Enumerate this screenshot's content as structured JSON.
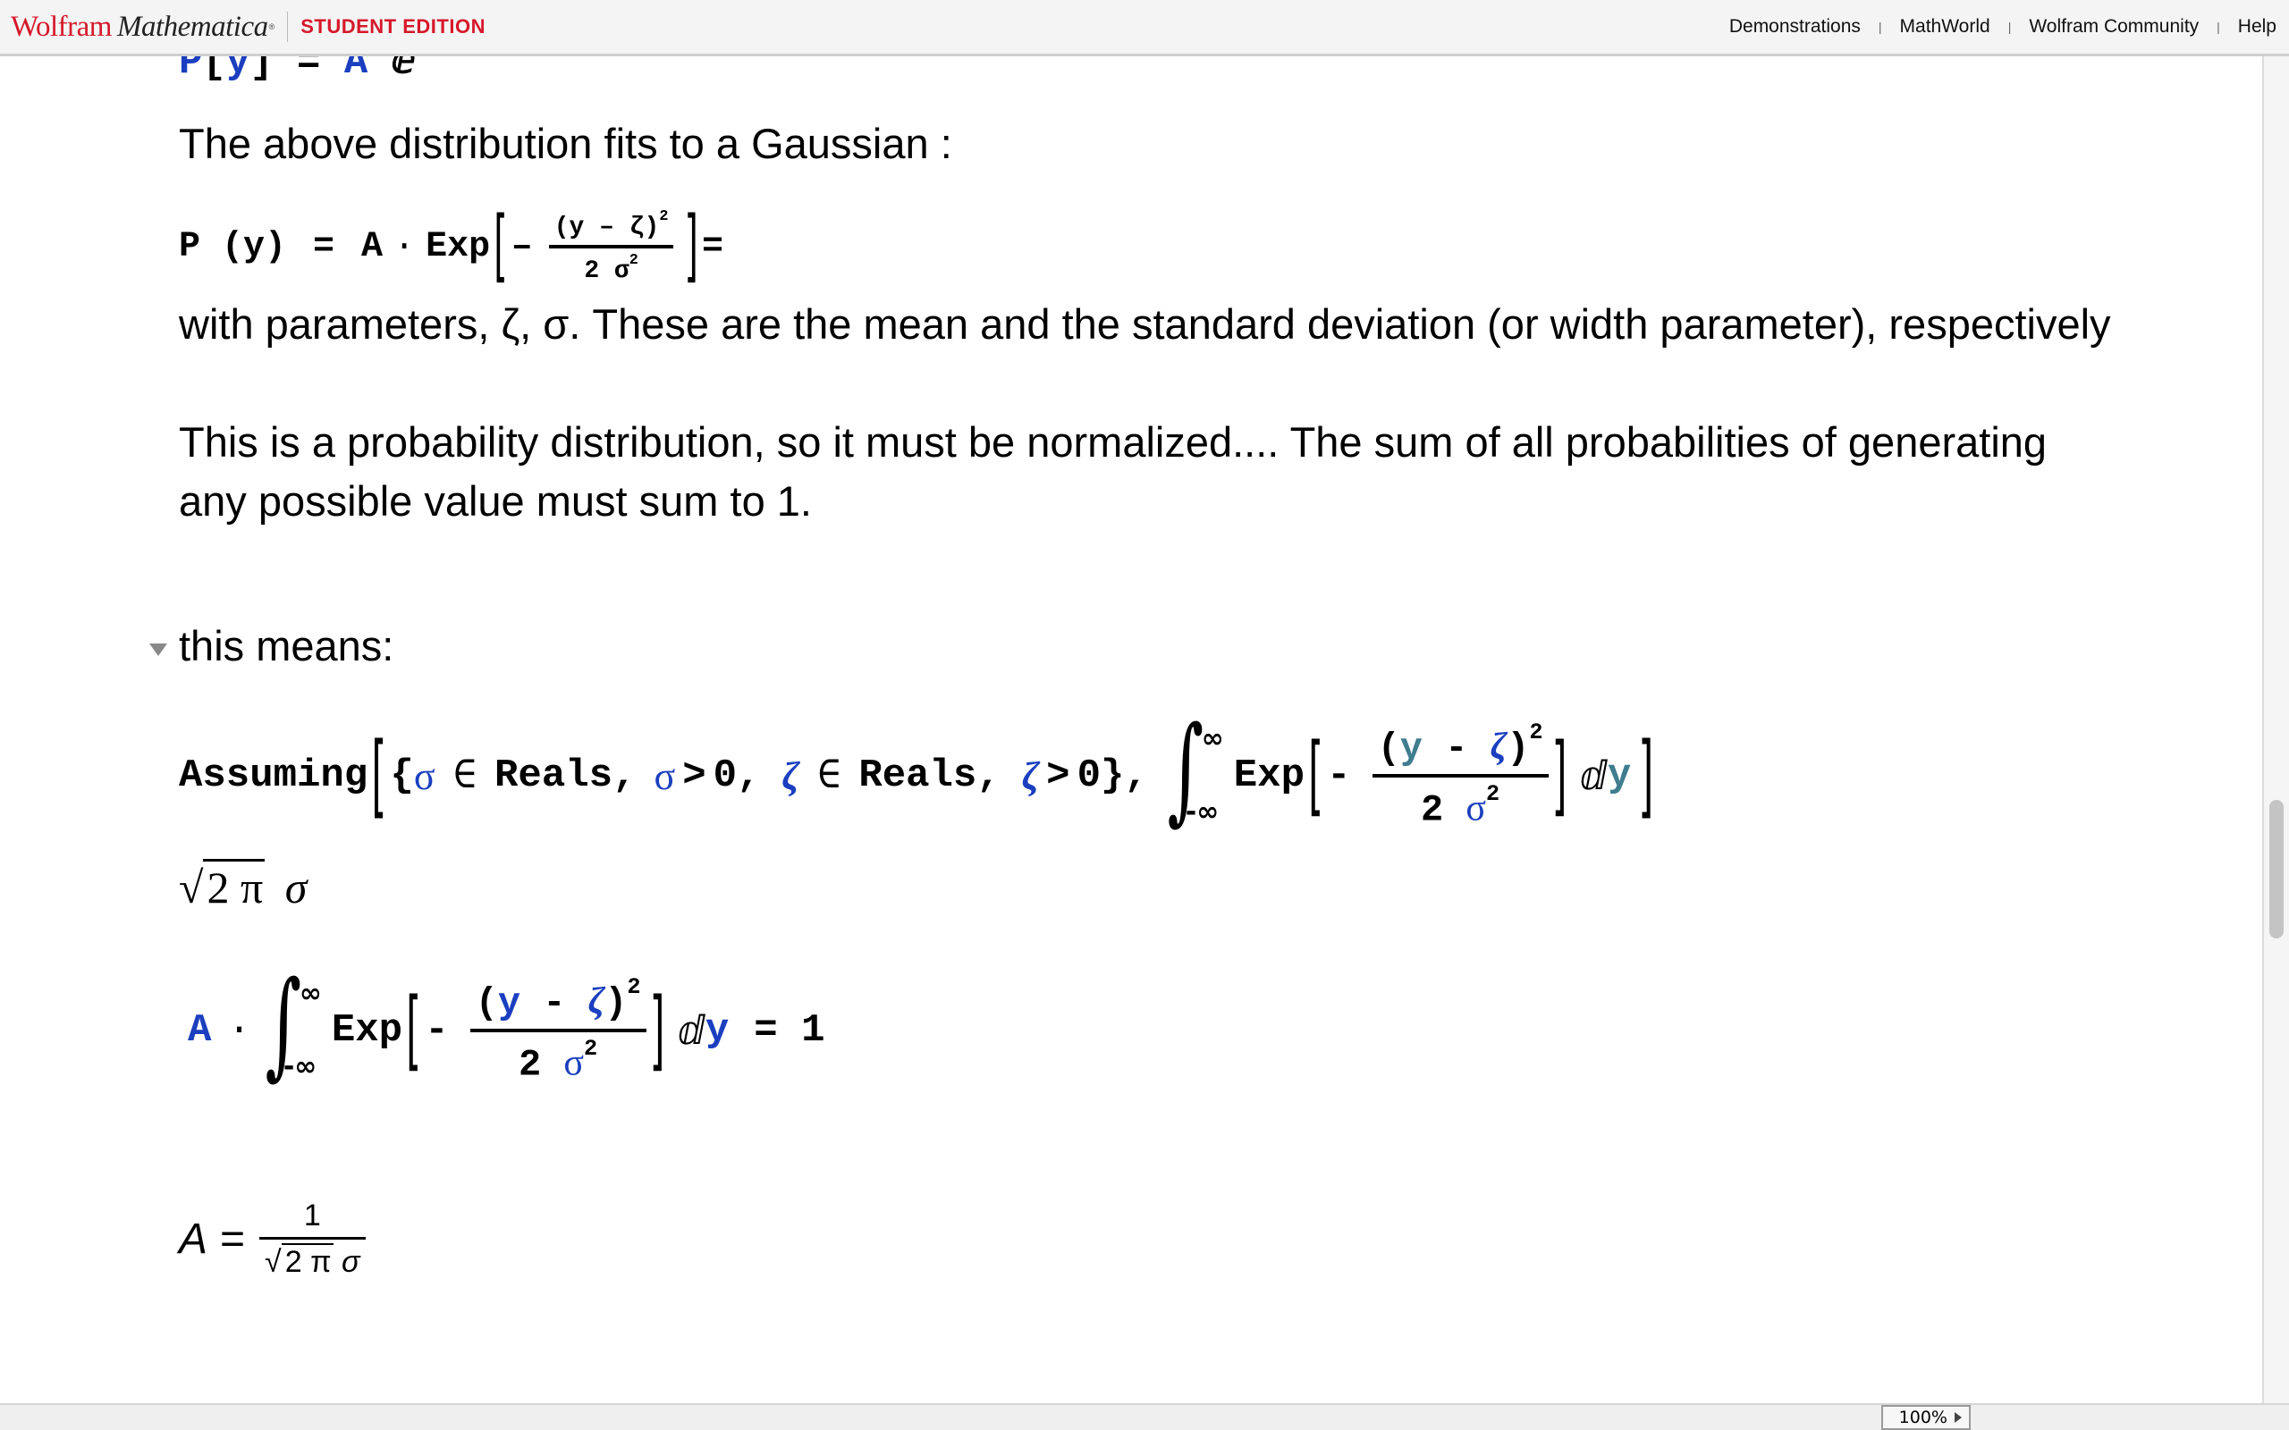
{
  "header": {
    "brand_wolfram": "Wolfram",
    "brand_mathematica": "Mathematica",
    "brand_tm": "®",
    "edition": "STUDENT EDITION",
    "links": [
      "Demonstrations",
      "MathWorld",
      "Wolfram Community",
      "Help"
    ],
    "link_separator": "|"
  },
  "notebook": {
    "partial_top_line": {
      "P": "P",
      "lbr": "[",
      "y": "y",
      "rbr": "]",
      "eq": "=",
      "A": "A",
      "e": "ⅇ"
    },
    "text_gaussian_intro": "The above distribution fits to a Gaussian :",
    "gaussian_formula": {
      "lhs": "P (y)",
      "eq": "=",
      "A": "A",
      "dot": "·",
      "fn": "Exp",
      "minus": "–",
      "numerator": "(y – ζ)",
      "num_exp": "2",
      "denominator": "2 σ",
      "den_exp": "2",
      "trailing": "="
    },
    "text_parameters": "with parameters, ζ, σ. These are the mean and the standard deviation (or width parameter), respectively",
    "text_normalize_line1": "This is a probability distribution, so it must be normalized.... The sum of all probabilities  of generating",
    "text_normalize_line2": "any possible value must sum to 1.",
    "section_heading": "this means:",
    "assuming_input": {
      "fn": "Assuming",
      "open_brace": "{",
      "sigma": "σ",
      "elem": "∈",
      "reals": "Reals",
      "comma": ",",
      "gt": ">",
      "zero": "0",
      "zeta": "ζ",
      "close_brace": "},",
      "int_upper": "∞",
      "int_lower": "-∞",
      "exp_fn": "Exp",
      "minus": "-",
      "y": "y",
      "num_minus": "-",
      "num_exp": "2",
      "den_two": "2",
      "den_exp": "2",
      "d": "ⅆ"
    },
    "assuming_output": {
      "root_arg": "2 π",
      "sigma": "σ"
    },
    "normalization_eq": {
      "A": "A",
      "dot": "·",
      "int_upper": "∞",
      "int_lower": "-∞",
      "exp_fn": "Exp",
      "minus": "-",
      "y": "y",
      "zeta": "ζ",
      "num_exp": "2",
      "den_two": "2",
      "sigma": "σ",
      "den_exp": "2",
      "d": "ⅆ",
      "equals": "= 1"
    },
    "result": {
      "lhs": "A",
      "eq": "=",
      "numerator": "1",
      "root_arg": "2 π",
      "sigma": "σ"
    }
  },
  "statusbar": {
    "zoom": "100%"
  },
  "colors": {
    "brand_red": "#d6182b",
    "symbol_blue": "#1b3fbf",
    "symbol_teal": "#3f7d8f"
  }
}
